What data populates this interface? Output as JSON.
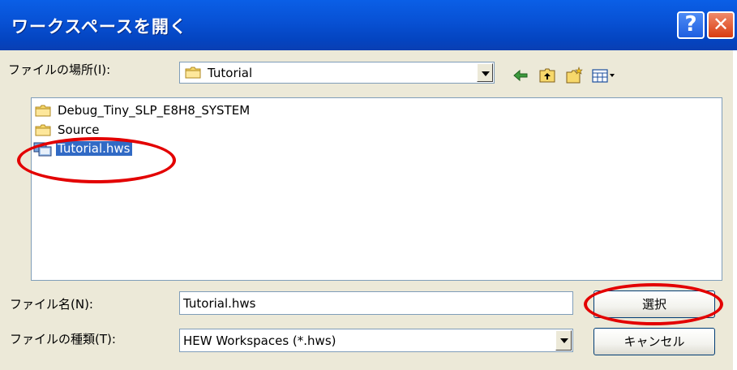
{
  "window": {
    "title": "ワークスペースを開く",
    "help_glyph": "?",
    "close_glyph": "✕"
  },
  "location": {
    "label": "ファイルの場所(I):",
    "value": "Tutorial"
  },
  "toolbar": {
    "icons": [
      "back-arrow-icon",
      "up-folder-icon",
      "new-folder-icon",
      "view-menu-icon"
    ]
  },
  "files": [
    {
      "name": "Debug_Tiny_SLP_E8H8_SYSTEM",
      "type": "folder"
    },
    {
      "name": "Source",
      "type": "folder"
    },
    {
      "name": "Tutorial.hws",
      "type": "workspace",
      "selected": true
    }
  ],
  "filename": {
    "label": "ファイル名(N):",
    "value": "Tutorial.hws"
  },
  "filetype": {
    "label": "ファイルの種類(T):",
    "value": "HEW Workspaces (*.hws)"
  },
  "buttons": {
    "select": "選択",
    "cancel": "キャンセル"
  },
  "colors": {
    "titlebar": "#0852d6",
    "selection": "#316ac5",
    "annotation": "#e30000"
  }
}
